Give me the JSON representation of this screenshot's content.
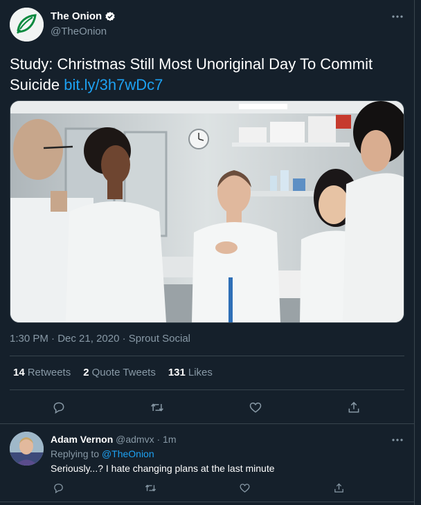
{
  "tweet": {
    "display_name": "The Onion",
    "handle": "@TheOnion",
    "text": "Study: Christmas Still Most Unoriginal Day To Commit Suicide",
    "link": "bit.ly/3h7wDc7",
    "time": "1:30 PM",
    "date": "Dec 21, 2020",
    "source": "Sprout Social",
    "separator": "·",
    "stats": {
      "retweets_count": "14",
      "retweets_label": "Retweets",
      "quotes_count": "2",
      "quotes_label": "Quote Tweets",
      "likes_count": "131",
      "likes_label": "Likes"
    },
    "icons": [
      "more-icon",
      "verified-icon",
      "reply-icon",
      "retweet-icon",
      "like-icon",
      "share-icon"
    ]
  },
  "reply": {
    "display_name": "Adam Vernon",
    "handle": "@admvx",
    "separator": "·",
    "age": "1m",
    "replying_prefix": "Replying to",
    "replying_to": "@TheOnion",
    "text": "Seriously...? I hate changing plans at the last minute"
  },
  "colors": {
    "background": "#15202b",
    "text": "#ffffff",
    "secondary_text": "#8899a6",
    "link": "#1da1f2",
    "divider": "#38444d"
  }
}
